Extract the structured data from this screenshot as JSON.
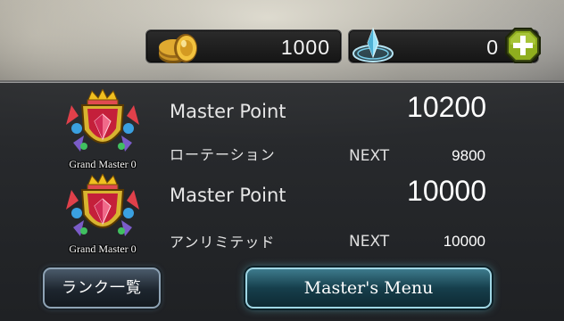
{
  "currency": {
    "gold_value": "1000",
    "crystal_value": "0",
    "gold_icon": "gold-coin-icon",
    "crystal_icon": "crystal-orb-icon",
    "add_icon": "plus-icon"
  },
  "ranks": [
    {
      "emblem_label": "Grand Master 0",
      "point_label": "Master Point",
      "point_value": "10200",
      "format_label": "ローテーション",
      "next_label": "NEXT",
      "next_value": "9800"
    },
    {
      "emblem_label": "Grand Master 0",
      "point_label": "Master Point",
      "point_value": "10000",
      "format_label": "アンリミテッド",
      "next_label": "NEXT",
      "next_value": "10000"
    }
  ],
  "buttons": {
    "rank_list": "ランク一覧",
    "master_menu": "Master's Menu"
  },
  "colors": {
    "gold": "#d4a11e",
    "crystal": "#6ed0f0",
    "plus_button": "#8fae1e",
    "master_button": "#1d5666"
  }
}
